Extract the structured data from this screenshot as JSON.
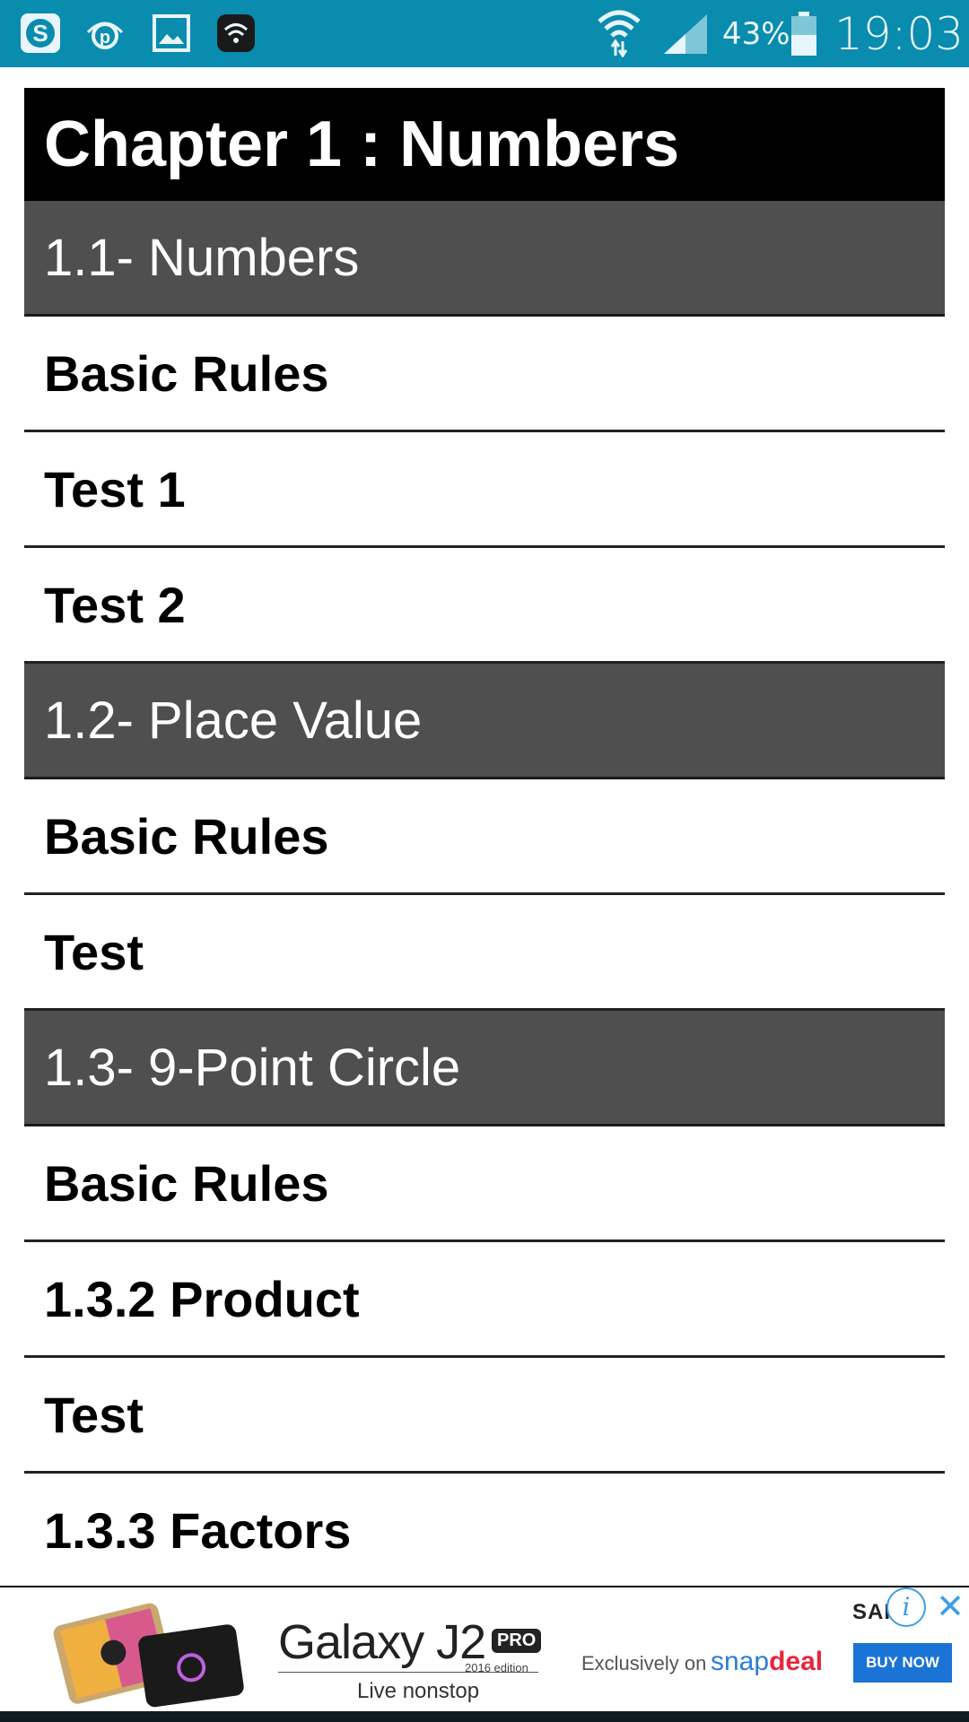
{
  "status_bar": {
    "battery_percent": "43%",
    "time": "19:03",
    "icons": [
      "skype-icon",
      "parking-app-icon",
      "gallery-icon",
      "wifi-app-icon",
      "wifi-signal-icon",
      "cellular-signal-icon",
      "battery-icon"
    ]
  },
  "chapter": {
    "title": "Chapter 1 : Numbers"
  },
  "rows": [
    {
      "type": "section",
      "label": "1.1- Numbers"
    },
    {
      "type": "item",
      "label": "Basic Rules"
    },
    {
      "type": "item",
      "label": "Test 1"
    },
    {
      "type": "item",
      "label": "Test 2"
    },
    {
      "type": "section",
      "label": "1.2- Place Value"
    },
    {
      "type": "item",
      "label": "Basic Rules"
    },
    {
      "type": "item",
      "label": "Test"
    },
    {
      "type": "section",
      "label": "1.3- 9-Point Circle"
    },
    {
      "type": "item",
      "label": "Basic Rules"
    },
    {
      "type": "item",
      "label": "1.3.2 Product"
    },
    {
      "type": "item",
      "label": "Test"
    },
    {
      "type": "item",
      "label": "1.3.3 Factors"
    }
  ],
  "ad": {
    "title": "Galaxy J2",
    "badge": "PRO",
    "edition": "2016 edition",
    "tagline": "Live nonstop",
    "exclusive_text": "Exclusively on",
    "brand_part1": "snap",
    "brand_part2": "deal",
    "buy_label": "BUY NOW",
    "advertiser_partial": "SAI"
  },
  "colors": {
    "status_bar": "#0a8cae",
    "chapter_bg": "#000000",
    "section_bg": "#4f4f4f",
    "item_bg": "#ffffff"
  }
}
